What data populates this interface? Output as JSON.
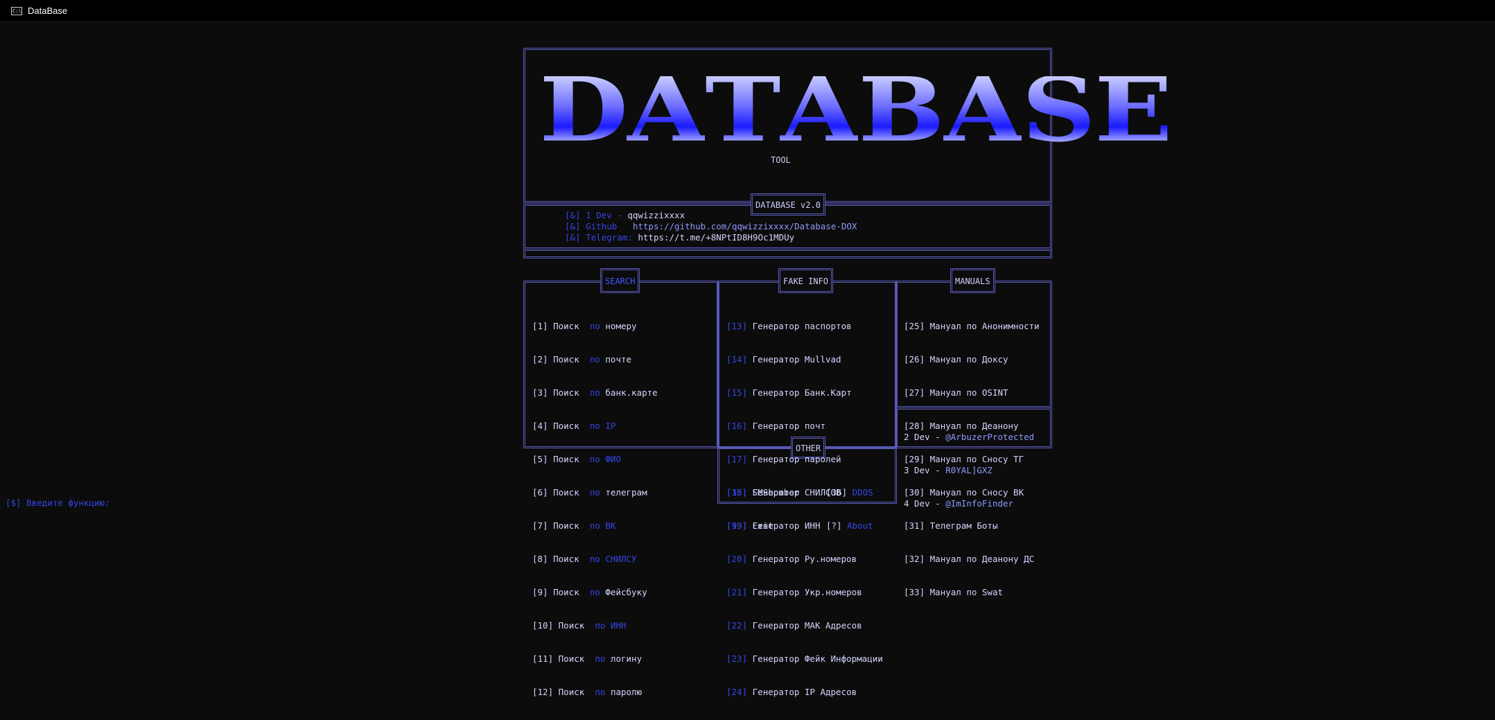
{
  "window": {
    "title": "DataBase",
    "icon": "console-icon"
  },
  "logo": {
    "letters": [
      "D",
      "A",
      "T",
      "A",
      "B",
      "A",
      "S",
      "E"
    ],
    "subtitle": "TOOL"
  },
  "version_tag": "DATABASE v2.0",
  "links": [
    {
      "prefix": "[&] ",
      "label": "1 Dev - ",
      "value": "qqwizzixxxx"
    },
    {
      "prefix": "[&] ",
      "label": "Github   ",
      "value": "https://github.com/qqwizzixxxx/Database-DOX"
    },
    {
      "prefix": "[&] ",
      "label": "Telegram: ",
      "value": "https://t.me/+8NPtID8H9Oc1MDUy"
    }
  ],
  "sections": {
    "search": {
      "title": "SEARCH",
      "items": [
        {
          "num": "[1]",
          "a": "Поиск",
          "b": "по",
          "c": "номеру"
        },
        {
          "num": "[2]",
          "a": "Поиск",
          "b": "по",
          "c": "почте"
        },
        {
          "num": "[3]",
          "a": "Поиск",
          "b": "по",
          "c": "банк.карте"
        },
        {
          "num": "[4]",
          "a": "Поиск",
          "b": "по",
          "c": "IP"
        },
        {
          "num": "[5]",
          "a": "Поиск",
          "b": "по",
          "c": "ФИО"
        },
        {
          "num": "[6]",
          "a": "Поиск",
          "b": "по",
          "c": "телеграм"
        },
        {
          "num": "[7]",
          "a": "Поиск",
          "b": "по",
          "c": "ВК"
        },
        {
          "num": "[8]",
          "a": "Поиск",
          "b": "по",
          "c": "СНИЛСУ"
        },
        {
          "num": "[9]",
          "a": "Поиск",
          "b": "по",
          "c": "Фейсбуку"
        },
        {
          "num": "[10]",
          "a": "Поиск",
          "b": "по",
          "c": "ИНН"
        },
        {
          "num": "[11]",
          "a": "Поиск",
          "b": "по",
          "c": "логину"
        },
        {
          "num": "[12]",
          "a": "Поиск",
          "b": "по",
          "c": "паролю"
        }
      ]
    },
    "fake_info": {
      "title": "FAKE INFO",
      "items": [
        {
          "num": "[13]",
          "text": "Генератор паспортов"
        },
        {
          "num": "[14]",
          "text": "Генератор Mullvad"
        },
        {
          "num": "[15]",
          "text": "Генератор Банк.Карт"
        },
        {
          "num": "[16]",
          "text": "Генератор почт"
        },
        {
          "num": "[17]",
          "text": "Генератор паролей"
        },
        {
          "num": "[18]",
          "text": "Генератор СНИЛСОВ"
        },
        {
          "num": "[19]",
          "text": "Генератор ИНН"
        },
        {
          "num": "[20]",
          "text": "Генератор Ру.номеров"
        },
        {
          "num": "[21]",
          "text": "Генератор Укр.номеров"
        },
        {
          "num": "[22]",
          "text": "Генератор МАК Адресов"
        },
        {
          "num": "[23]",
          "text": "Генератор Фейк Информации"
        },
        {
          "num": "[24]",
          "text": "Генератор IP Адресов"
        }
      ]
    },
    "manuals": {
      "title": "MANUALS",
      "items": [
        {
          "num": "[25]",
          "text": "Мануал по Анонимности"
        },
        {
          "num": "[26]",
          "text": "Мануал по Доксу"
        },
        {
          "num": "[27]",
          "text": "Мануал по OSINT"
        },
        {
          "num": "[28]",
          "text": "Мануал по Деанону"
        },
        {
          "num": "[29]",
          "text": "Мануал по Сносу ТГ"
        },
        {
          "num": "[30]",
          "text": "Мануал по Сносу ВК"
        },
        {
          "num": "[31]",
          "text": "Телеграм Боты"
        },
        {
          "num": "[32]",
          "text": "Мануал по Деанону ДС"
        },
        {
          "num": "[33]",
          "text": "Мануал по Swat"
        }
      ]
    },
    "devs": [
      {
        "label": "2 Dev - ",
        "value": "@ArbuzerProtected"
      },
      {
        "label": "3 Dev - ",
        "value": "R0YAL]GXZ"
      },
      {
        "label": "4 Dev - ",
        "value": "@ImInfoFinder"
      }
    ],
    "other": {
      "title": "OTHER",
      "left": [
        {
          "num": "[35]",
          "text": "SMSbomber"
        },
        {
          "num": "[99]",
          "text": "Exit"
        }
      ],
      "right": [
        {
          "num": "[36]",
          "text": "DDOS"
        },
        {
          "num": "[?]",
          "text": "About"
        }
      ]
    }
  },
  "prompt": "[$] Введите функцию:",
  "colors": {
    "background": "#0c0c0c",
    "accent_blue": "#3346e8",
    "border": "#5a5ab8",
    "text": "#d4d6ff"
  }
}
